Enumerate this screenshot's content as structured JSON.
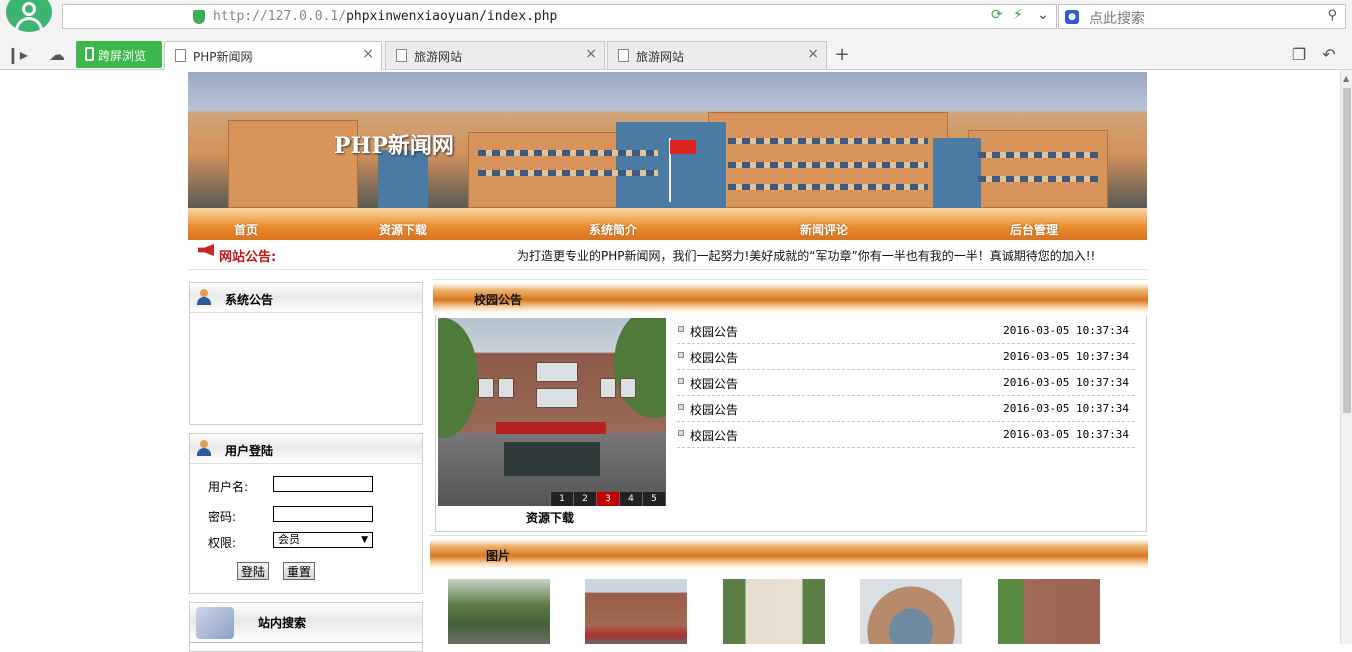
{
  "browser": {
    "url_host": "http://127.0.0.1/",
    "url_path": "phpxinwenxiaoyuan/index.php",
    "search_placeholder": "点此搜索",
    "green_button_label": "跨屏浏览",
    "tabs": [
      {
        "label": "PHP新闻网",
        "active": true
      },
      {
        "label": "旅游网站",
        "active": false
      },
      {
        "label": "旅游网站",
        "active": false
      }
    ],
    "icons": [
      "user-avatar-icon",
      "back-arrow-icon",
      "stop-icon",
      "home-icon",
      "star-icon",
      "shield-icon",
      "refresh-icon",
      "bolt-icon",
      "chevron-down-icon",
      "paw-icon",
      "search-icon",
      "sidebar-toggle-icon",
      "cloud-icon",
      "phone-icon",
      "new-tab-icon",
      "restore-icon",
      "undo-icon"
    ]
  },
  "site": {
    "banner_title": "PHP新闻网",
    "nav": [
      "首页",
      "资源下载",
      "系统简介",
      "新闻评论",
      "后台管理"
    ],
    "notice_label": "网站公告:",
    "notice_text": "为打造更专业的PHP新闻网，我们一起努力!美好成就的“军功章”你有一半也有我的一半！真诚期待您的加入!!"
  },
  "sidebar": {
    "announce_title": "系统公告",
    "login_title": "用户登陆",
    "username_label": "用户名:",
    "password_label": "密码:",
    "role_label": "权限:",
    "role_selected": "会员",
    "login_button": "登陆",
    "reset_button": "重置",
    "search_title": "站内搜索"
  },
  "main": {
    "campus_title": "校园公告",
    "photo_caption": "资源下载",
    "pager": [
      "1",
      "2",
      "3",
      "4",
      "5"
    ],
    "pager_active": "3",
    "news": [
      {
        "title": "校园公告",
        "date": "2016-03-05 10:37:34"
      },
      {
        "title": "校园公告",
        "date": "2016-03-05 10:37:34"
      },
      {
        "title": "校园公告",
        "date": "2016-03-05 10:37:34"
      },
      {
        "title": "校园公告",
        "date": "2016-03-05 10:37:34"
      },
      {
        "title": "校园公告",
        "date": "2016-03-05 10:37:34"
      }
    ],
    "pictures_title": "图片",
    "accent_color": "#e38a34",
    "notice_color": "#c0161b"
  }
}
